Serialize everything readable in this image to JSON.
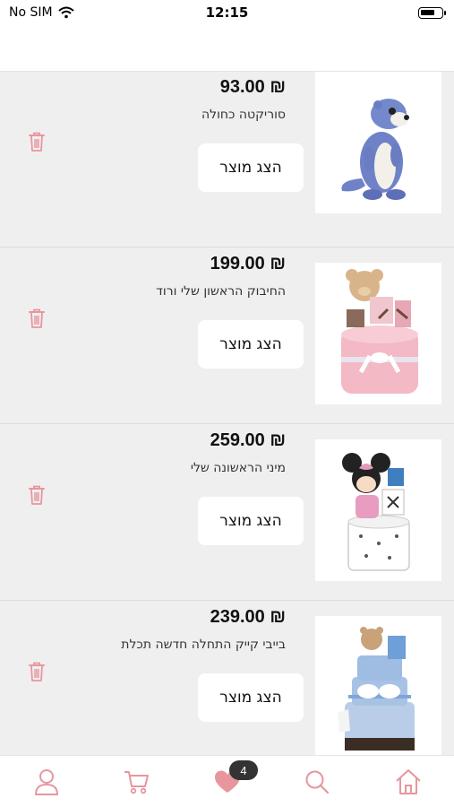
{
  "status_bar": {
    "carrier": "No SIM",
    "time": "12:15"
  },
  "wishlist": {
    "items": [
      {
        "price": "93.00 ₪",
        "name": "סוריקטה כחולה",
        "button_label": "הצג מוצר",
        "image": "blue-meerkat-plush"
      },
      {
        "price": "199.00 ₪",
        "name": "החיבוק הראשון שלי ורוד",
        "button_label": "הצג מוצר",
        "image": "pink-teddy-gift-basket"
      },
      {
        "price": "259.00 ₪",
        "name": "מיני הראשונה שלי",
        "button_label": "הצג מוצר",
        "image": "minnie-gift-basket"
      },
      {
        "price": "239.00 ₪",
        "name": "בייבי קייק התחלה חדשה תכלת",
        "button_label": "הצג מוצר",
        "image": "blue-diaper-cake"
      }
    ]
  },
  "tabbar": {
    "items": [
      "profile-icon",
      "cart-icon",
      "heart-icon",
      "search-icon",
      "home-icon"
    ],
    "wishlist_count": "4",
    "accent_color": "#e7969e"
  }
}
